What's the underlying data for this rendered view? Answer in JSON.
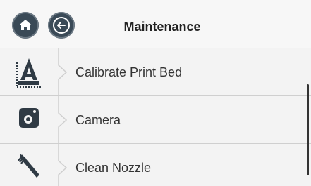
{
  "header": {
    "title": "Maintenance",
    "home_icon": "home-icon",
    "back_icon": "back-arrow-icon"
  },
  "items": [
    {
      "label": "Calibrate Print Bed",
      "icon": "calibrate-bed-icon"
    },
    {
      "label": "Camera",
      "icon": "camera-icon"
    },
    {
      "label": "Clean Nozzle",
      "icon": "clean-nozzle-icon"
    }
  ],
  "colors": {
    "accent": "#3a4a57",
    "background": "#f4f4f4"
  }
}
